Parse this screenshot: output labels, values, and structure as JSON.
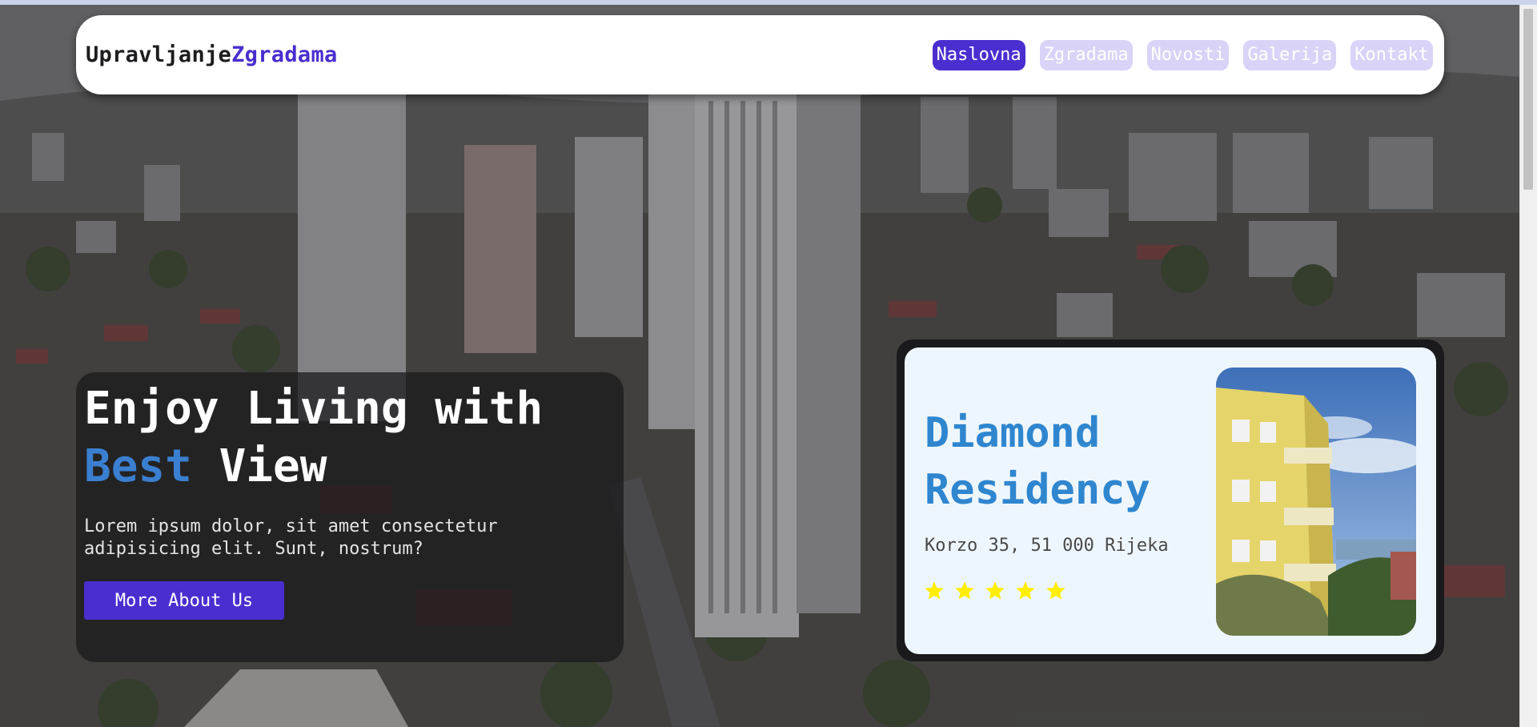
{
  "brand": {
    "part1": "Upravljanje",
    "part2": "Zgradama",
    "accent_color": "#4b2ecf"
  },
  "nav": {
    "items": [
      {
        "label": "Naslovna",
        "active": true
      },
      {
        "label": "Zgradama",
        "active": false
      },
      {
        "label": "Novosti",
        "active": false
      },
      {
        "label": "Galerija",
        "active": false
      },
      {
        "label": "Kontakt",
        "active": false
      }
    ]
  },
  "hero": {
    "title_line1": "Enjoy Living with",
    "title_highlight": "Best",
    "title_rest": " View",
    "description": "Lorem ipsum dolor, sit amet consectetur adipisicing elit. Sunt, nostrum?",
    "cta_label": "More About Us"
  },
  "property": {
    "name": "Diamond Residency",
    "address": "Korzo 35, 51 000 Rijeka",
    "rating": 5,
    "star_color": "#ffee00",
    "title_color": "#2f86cf"
  }
}
